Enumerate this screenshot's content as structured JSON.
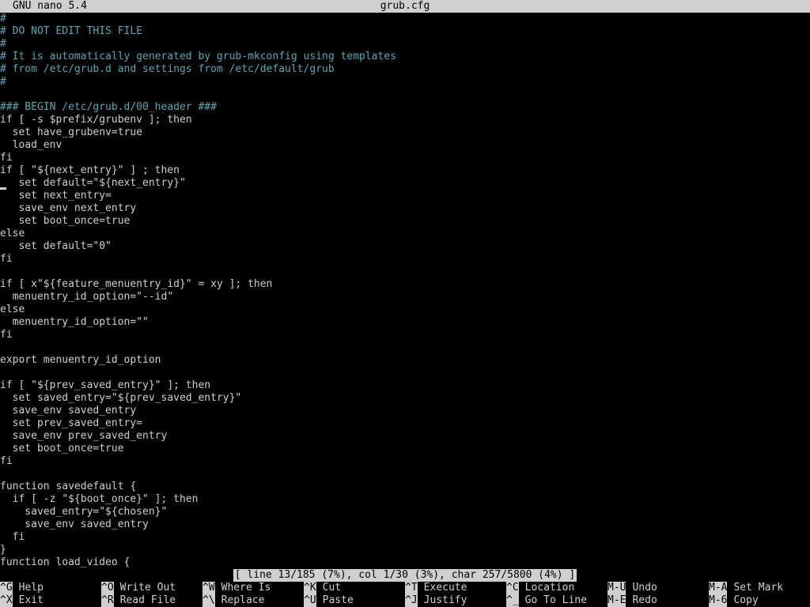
{
  "titlebar": {
    "app": "GNU nano 5.4",
    "filename": "grub.cfg"
  },
  "editor": {
    "lines": [
      {
        "text": "#",
        "comment": true
      },
      {
        "text": "# DO NOT EDIT THIS FILE",
        "comment": true
      },
      {
        "text": "#",
        "comment": true
      },
      {
        "text": "# It is automatically generated by grub-mkconfig using templates",
        "comment": true
      },
      {
        "text": "# from /etc/grub.d and settings from /etc/default/grub",
        "comment": true
      },
      {
        "text": "#",
        "comment": true
      },
      {
        "text": "",
        "comment": false
      },
      {
        "text": "### BEGIN /etc/grub.d/00_header ###",
        "comment": true
      },
      {
        "text": "if [ -s $prefix/grubenv ]; then",
        "comment": false
      },
      {
        "text": "  set have_grubenv=true",
        "comment": false
      },
      {
        "text": "  load_env",
        "comment": false
      },
      {
        "text": "fi",
        "comment": false
      },
      {
        "text": "if [ \"${next_entry}\" ] ; then",
        "comment": false
      },
      {
        "text": "   set default=\"${next_entry}\"",
        "comment": false
      },
      {
        "text": "   set next_entry=",
        "comment": false
      },
      {
        "text": "   save_env next_entry",
        "comment": false
      },
      {
        "text": "   set boot_once=true",
        "comment": false
      },
      {
        "text": "else",
        "comment": false
      },
      {
        "text": "   set default=\"0\"",
        "comment": false
      },
      {
        "text": "fi",
        "comment": false
      },
      {
        "text": "",
        "comment": false
      },
      {
        "text": "if [ x\"${feature_menuentry_id}\" = xy ]; then",
        "comment": false
      },
      {
        "text": "  menuentry_id_option=\"--id\"",
        "comment": false
      },
      {
        "text": "else",
        "comment": false
      },
      {
        "text": "  menuentry_id_option=\"\"",
        "comment": false
      },
      {
        "text": "fi",
        "comment": false
      },
      {
        "text": "",
        "comment": false
      },
      {
        "text": "export menuentry_id_option",
        "comment": false
      },
      {
        "text": "",
        "comment": false
      },
      {
        "text": "if [ \"${prev_saved_entry}\" ]; then",
        "comment": false
      },
      {
        "text": "  set saved_entry=\"${prev_saved_entry}\"",
        "comment": false
      },
      {
        "text": "  save_env saved_entry",
        "comment": false
      },
      {
        "text": "  set prev_saved_entry=",
        "comment": false
      },
      {
        "text": "  save_env prev_saved_entry",
        "comment": false
      },
      {
        "text": "  set boot_once=true",
        "comment": false
      },
      {
        "text": "fi",
        "comment": false
      },
      {
        "text": "",
        "comment": false
      },
      {
        "text": "function savedefault {",
        "comment": false
      },
      {
        "text": "  if [ -z \"${boot_once}\" ]; then",
        "comment": false
      },
      {
        "text": "    saved_entry=\"${chosen}\"",
        "comment": false
      },
      {
        "text": "    save_env saved_entry",
        "comment": false
      },
      {
        "text": "  fi",
        "comment": false
      },
      {
        "text": "}",
        "comment": false
      },
      {
        "text": "function load_video {",
        "comment": false
      }
    ]
  },
  "status": {
    "text": "[ line 13/185 (7%), col 1/30 (3%), char 257/5800 (4%) ]"
  },
  "shortcuts": [
    {
      "key": "^G",
      "label": "Help"
    },
    {
      "key": "^O",
      "label": "Write Out"
    },
    {
      "key": "^W",
      "label": "Where Is"
    },
    {
      "key": "^K",
      "label": "Cut"
    },
    {
      "key": "^T",
      "label": "Execute"
    },
    {
      "key": "^C",
      "label": "Location"
    },
    {
      "key": "M-U",
      "label": "Undo"
    },
    {
      "key": "M-A",
      "label": "Set Mark"
    },
    {
      "key": "^X",
      "label": "Exit"
    },
    {
      "key": "^R",
      "label": "Read File"
    },
    {
      "key": "^\\",
      "label": "Replace"
    },
    {
      "key": "^U",
      "label": "Paste"
    },
    {
      "key": "^J",
      "label": "Justify"
    },
    {
      "key": "^_",
      "label": "Go To Line"
    },
    {
      "key": "M-E",
      "label": "Redo"
    },
    {
      "key": "M-6",
      "label": "Copy"
    }
  ],
  "colors": {
    "background": "#000000",
    "foreground": "#cfcfcf",
    "comment": "#53a9b5",
    "inverse_bg": "#cfcfcf"
  }
}
